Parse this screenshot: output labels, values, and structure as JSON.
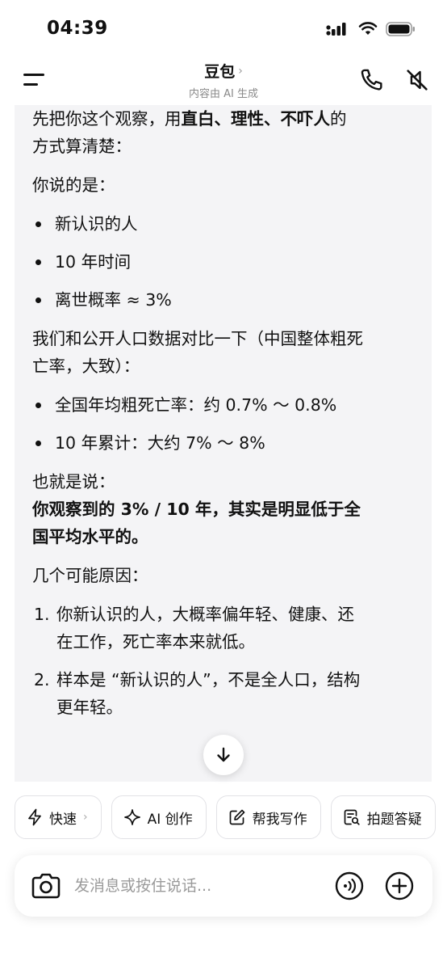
{
  "status_bar": {
    "time": "04:39"
  },
  "header": {
    "title": "豆包",
    "title_chevron": "›",
    "subtitle": "内容由 AI 生成"
  },
  "message": {
    "intro_line1_prefix": "先把你这个观察，用",
    "intro_line1_bold": "直白、理性、不吓人",
    "intro_line1_suffix": "的",
    "intro_line2": "方式算清楚：",
    "you_said": "你说的是：",
    "points": [
      "新认识的人",
      "10 年时间",
      "离世概率 ≈ 3%"
    ],
    "compare_line1": "我们和公开人口数据对比一下（中国整体粗死",
    "compare_line2": "亡率，大致）：",
    "stats": [
      "全国年均粗死亡率：约 0.7% ～ 0.8%",
      "10 年累计：大约 7% ～ 8%"
    ],
    "that_is": "也就是说：",
    "conclusion_line1": "你观察到的 3% / 10 年，其实是明显低于全",
    "conclusion_line2": "国平均水平的。",
    "reasons_title": "几个可能原因：",
    "reasons": [
      {
        "num": "1.",
        "line1": "你新认识的人，大概率偏年轻、健康、还",
        "line2": "在工作，死亡率本来就低。"
      },
      {
        "num": "2.",
        "line1": "样本是 “新认识的人”，不是全人口，结构",
        "line2": "更年轻。"
      }
    ]
  },
  "chips": [
    {
      "icon": "lightning-icon",
      "label": "快速",
      "chevron": "›"
    },
    {
      "icon": "sparkle-icon",
      "label": "AI 创作"
    },
    {
      "icon": "edit-icon",
      "label": "帮我写作"
    },
    {
      "icon": "document-search-icon",
      "label": "拍题答疑"
    }
  ],
  "input": {
    "placeholder": "发消息或按住说话..."
  }
}
